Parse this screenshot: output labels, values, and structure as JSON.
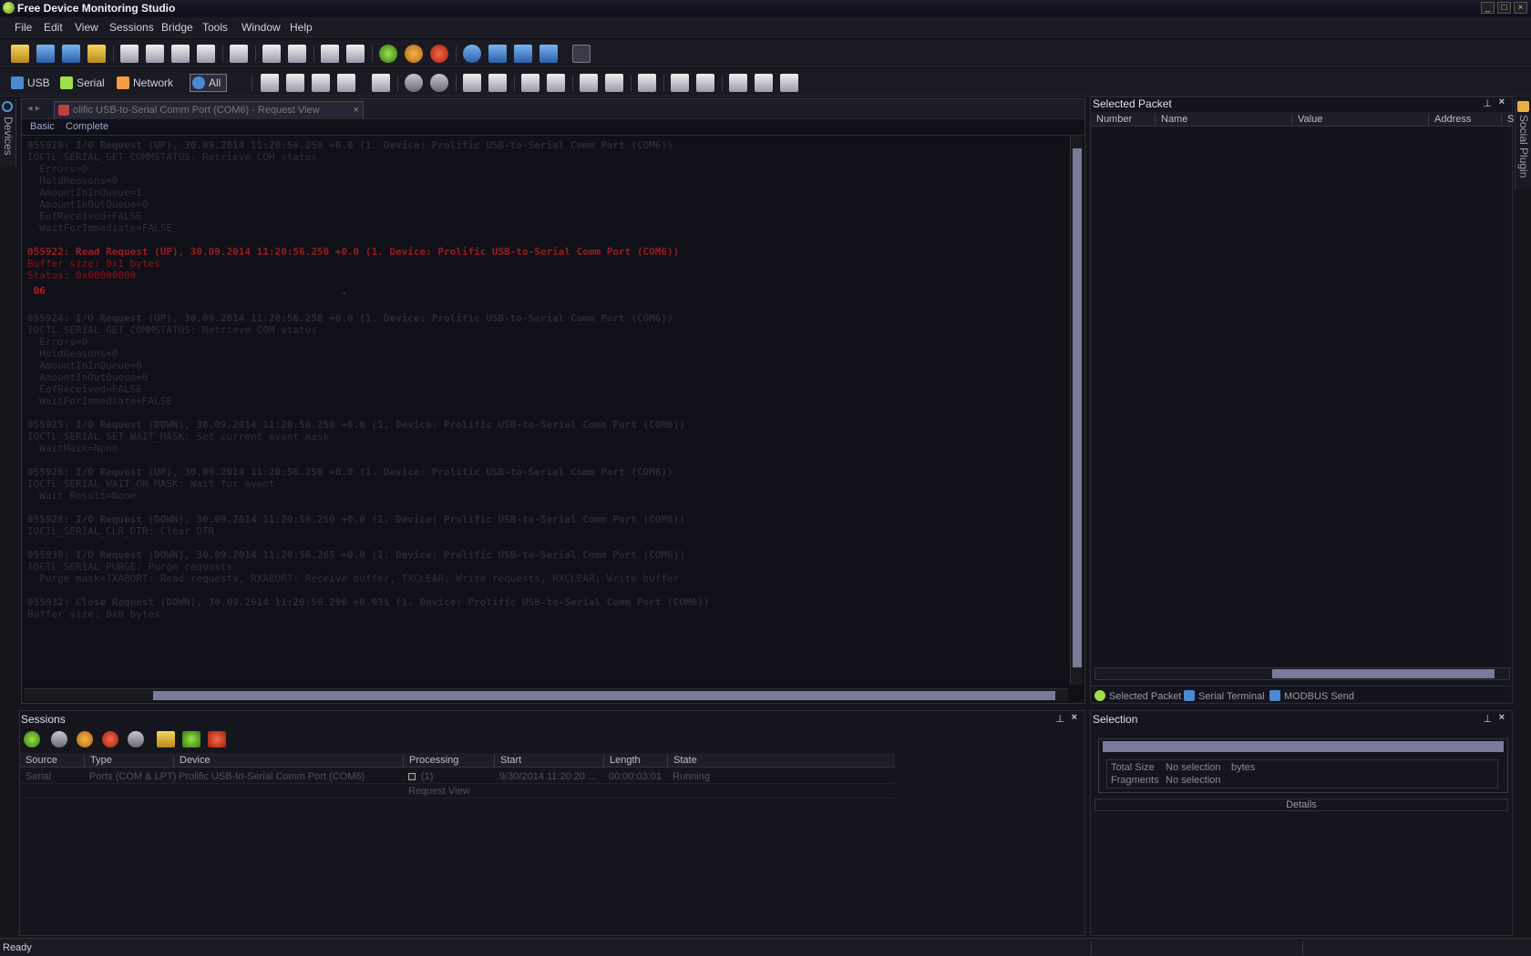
{
  "window": {
    "title": "Free Device Monitoring Studio"
  },
  "menu": [
    "File",
    "Edit",
    "View",
    "Sessions",
    "Bridge",
    "Tools",
    "Window",
    "Help"
  ],
  "toolbar2": {
    "usb": "USB",
    "serial": "Serial",
    "network": "Network",
    "all": "All"
  },
  "left_dock": {
    "label": "Devices"
  },
  "right_dock": {
    "label": "Social Plugin"
  },
  "document": {
    "tab_title": "olific USB-to-Serial Comm Port (COM6) - Request View",
    "subtabs": [
      "Basic",
      "Complete"
    ],
    "lines": [
      {
        "t": "h",
        "s": "055920: I/O Request (UP), 30.09.2014 11:20:56.250 +0.0 (1. Device: Prolific USB-to-Serial Comm Port (COM6))"
      },
      {
        "t": "n",
        "s": "IOCTL_SERIAL_GET_COMMSTATUS: Retrieve COM status"
      },
      {
        "t": "n",
        "s": "  Errors=0"
      },
      {
        "t": "n",
        "s": "  HoldReasons=0"
      },
      {
        "t": "n",
        "s": "  AmountInInQueue=1"
      },
      {
        "t": "n",
        "s": "  AmountInOutQueue=0"
      },
      {
        "t": "n",
        "s": "  EofReceived=FALSE"
      },
      {
        "t": "n",
        "s": "  WaitForImmediate=FALSE"
      },
      {
        "t": "b",
        "s": ""
      },
      {
        "t": "rh",
        "s": "055922: Read Request (UP), 30.09.2014 11:20:56.250 +0.0 (1. Device: Prolific USB-to-Serial Comm Port (COM6))"
      },
      {
        "t": "r",
        "s": "Buffer size: 0x1 bytes"
      },
      {
        "t": "r",
        "s": "Status: 0x00000000"
      },
      {
        "t": "hex",
        "s": " 06                                                 ."
      },
      {
        "t": "b",
        "s": ""
      },
      {
        "t": "h",
        "s": "055924: I/O Request (UP), 30.09.2014 11:20:56.250 +0.0 (1. Device: Prolific USB-to-Serial Comm Port (COM6))"
      },
      {
        "t": "n",
        "s": "IOCTL_SERIAL_GET_COMMSTATUS: Retrieve COM status"
      },
      {
        "t": "n",
        "s": "  Errors=0"
      },
      {
        "t": "n",
        "s": "  HoldReasons=0"
      },
      {
        "t": "n",
        "s": "  AmountInInQueue=0"
      },
      {
        "t": "n",
        "s": "  AmountInOutQueue=0"
      },
      {
        "t": "n",
        "s": "  EofReceived=FALSE"
      },
      {
        "t": "n",
        "s": "  WaitForImmediate=FALSE"
      },
      {
        "t": "b",
        "s": ""
      },
      {
        "t": "h",
        "s": "055925: I/O Request (DOWN), 30.09.2014 11:20:56.250 +0.0 (1. Device: Prolific USB-to-Serial Comm Port (COM6))"
      },
      {
        "t": "n",
        "s": "IOCTL_SERIAL_SET_WAIT_MASK: Set current event mask"
      },
      {
        "t": "n",
        "s": "  WaitMask=None"
      },
      {
        "t": "b",
        "s": ""
      },
      {
        "t": "h",
        "s": "055926: I/O Request (UP), 30.09.2014 11:20:56.250 +0.0 (1. Device: Prolific USB-to-Serial Comm Port (COM6))"
      },
      {
        "t": "n",
        "s": "IOCTL_SERIAL_WAIT_ON_MASK: Wait for event"
      },
      {
        "t": "n",
        "s": "  Wait Result=None"
      },
      {
        "t": "b",
        "s": ""
      },
      {
        "t": "h",
        "s": "055928: I/O Request (DOWN), 30.09.2014 11:20:56.250 +0.0 (1. Device: Prolific USB-to-Serial Comm Port (COM6))"
      },
      {
        "t": "n",
        "s": "IOCTL_SERIAL_CLR_DTR: Clear DTR"
      },
      {
        "t": "b",
        "s": ""
      },
      {
        "t": "h",
        "s": "055930: I/O Request (DOWN), 30.09.2014 11:20:56.265 +0.0 (1. Device: Prolific USB-to-Serial Comm Port (COM6))"
      },
      {
        "t": "n",
        "s": "IOCTL_SERIAL_PURGE: Purge requests"
      },
      {
        "t": "n",
        "s": "  Purge mask=TXABORT: Read requests, RXABORT: Receive buffer, TXCLEAR: Write requests, RXCLEAR: Write buffer"
      },
      {
        "t": "b",
        "s": ""
      },
      {
        "t": "h",
        "s": "055932: Close Request (DOWN), 30.09.2014 11:20:56.296 +0.031 (1. Device: Prolific USB-to-Serial Comm Port (COM6))"
      },
      {
        "t": "n",
        "s": "Buffer size: 0x0 bytes"
      }
    ]
  },
  "selected_packet": {
    "title": "Selected Packet",
    "columns": [
      "Number",
      "Name",
      "Value",
      "Address",
      "S"
    ],
    "tabs": [
      "Selected Packet",
      "Serial Terminal",
      "MODBUS Send"
    ]
  },
  "sessions": {
    "title": "Sessions",
    "columns": [
      "Source",
      "Type",
      "Device",
      "Processing",
      "Start",
      "Length",
      "State"
    ],
    "rows": [
      {
        "source": "Serial",
        "type": "Ports (COM & LPT)",
        "device": "Prolific USB-to-Serial Comm Port (COM6)",
        "processing": "(1)",
        "start": "9/30/2014 11:20:20 ...",
        "length": "00:00:03:01",
        "state": "Running"
      },
      {
        "source": "",
        "type": "",
        "device": "",
        "processing": "Request View",
        "start": "",
        "length": "",
        "state": ""
      }
    ]
  },
  "selection": {
    "title": "Selection",
    "total_size_label": "Total Size",
    "total_size_value": "No selection",
    "total_size_unit": "bytes",
    "fragments_label": "Fragments",
    "fragments_value": "No selection",
    "details_label": "Details"
  },
  "status": {
    "text": "Ready"
  }
}
